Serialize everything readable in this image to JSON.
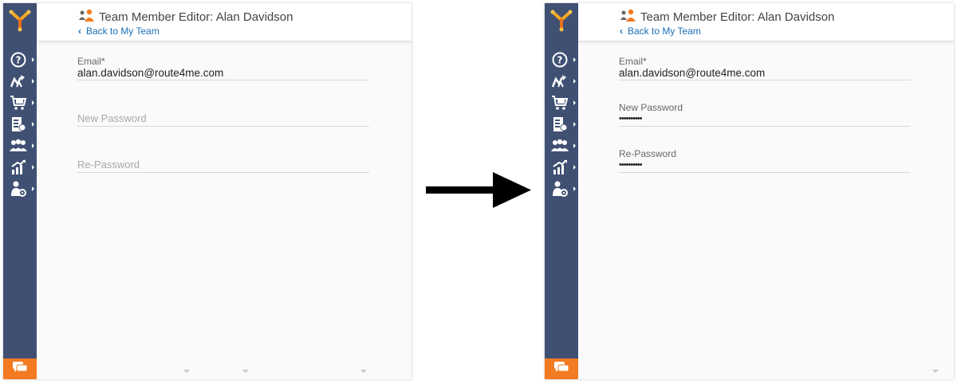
{
  "panels": [
    {
      "title": "Team Member Editor: Alan Davidson",
      "back_label": "Back to My Team",
      "email": {
        "label": "Email*",
        "value": "alan.davidson@route4me.com"
      },
      "new_password": {
        "label": "New Password",
        "placeholder": "New Password",
        "value": ""
      },
      "re_password": {
        "label": "Re-Password",
        "placeholder": "Re-Password",
        "value": ""
      }
    },
    {
      "title": "Team Member Editor: Alan Davidson",
      "back_label": "Back to My Team",
      "email": {
        "label": "Email*",
        "value": "alan.davidson@route4me.com"
      },
      "new_password": {
        "label": "New Password",
        "value": "••••••••••"
      },
      "re_password": {
        "label": "Re-Password",
        "value": "••••••••••"
      }
    }
  ],
  "sidebar": {
    "icons": [
      "help-icon",
      "routes-icon",
      "cart-icon",
      "address-book-icon",
      "team-icon",
      "analytics-icon",
      "user-settings-icon"
    ],
    "chat_icon": "chat-icon"
  },
  "colors": {
    "sidebar_bg": "#3f5073",
    "accent_orange": "#f27b22",
    "link_blue": "#1a6fb5"
  }
}
